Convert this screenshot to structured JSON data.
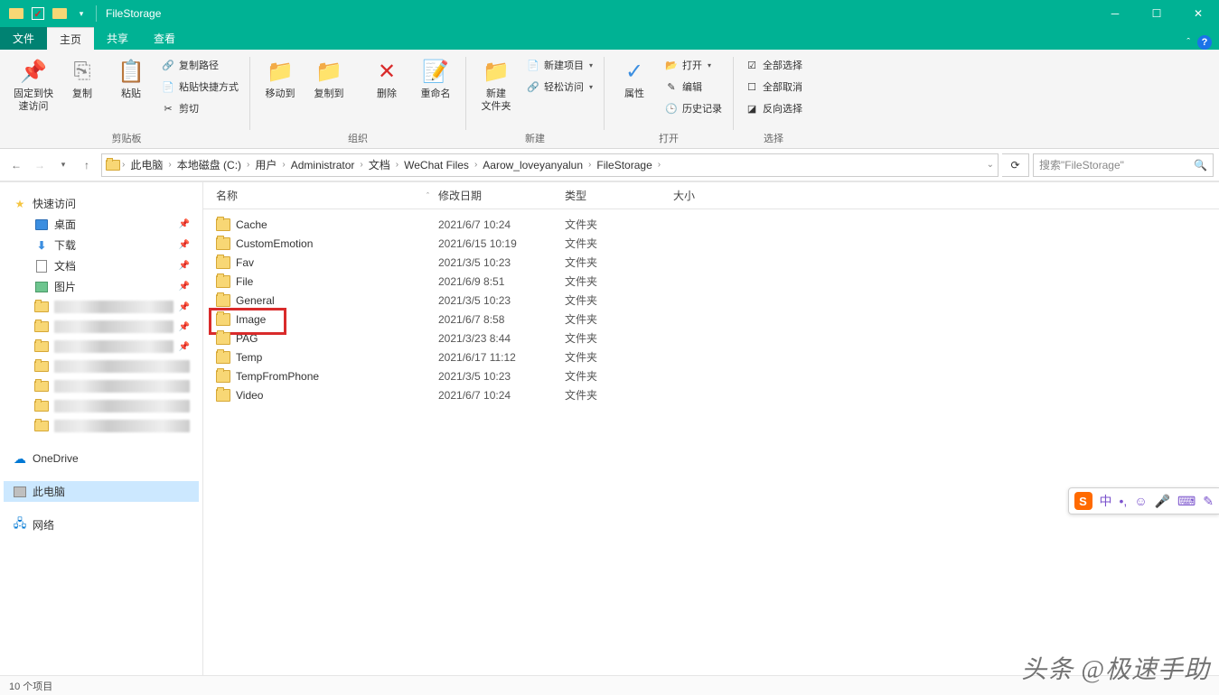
{
  "window": {
    "title": "FileStorage"
  },
  "menutabs": {
    "file": "文件",
    "home": "主页",
    "share": "共享",
    "view": "查看"
  },
  "ribbon": {
    "pin": "固定到快速访问",
    "copy": "复制",
    "paste": "粘贴",
    "copypath": "复制路径",
    "pasteshortcut": "粘贴快捷方式",
    "cut": "剪切",
    "clipboard_label": "剪贴板",
    "moveto": "移动到",
    "copyto": "复制到",
    "delete": "删除",
    "rename": "重命名",
    "organize_label": "组织",
    "newfolder": "新建\n文件夹",
    "newitem": "新建项目",
    "easyaccess": "轻松访问",
    "new_label": "新建",
    "properties": "属性",
    "open": "打开",
    "edit": "编辑",
    "history": "历史记录",
    "open_label": "打开",
    "selectall": "全部选择",
    "selectnone": "全部取消",
    "invert": "反向选择",
    "select_label": "选择"
  },
  "breadcrumb": [
    "此电脑",
    "本地磁盘 (C:)",
    "用户",
    "Administrator",
    "文档",
    "WeChat Files",
    "Aarow_loveyanyalun",
    "FileStorage"
  ],
  "search": {
    "placeholder": "搜索\"FileStorage\""
  },
  "tree": {
    "quick": "快速访问",
    "desktop": "桌面",
    "downloads": "下载",
    "documents": "文档",
    "pictures": "图片",
    "onedrive": "OneDrive",
    "thispc": "此电脑",
    "network": "网络"
  },
  "columns": {
    "name": "名称",
    "date": "修改日期",
    "type": "类型",
    "size": "大小"
  },
  "files": [
    {
      "name": "Cache",
      "date": "2021/6/7 10:24",
      "type": "文件夹"
    },
    {
      "name": "CustomEmotion",
      "date": "2021/6/15 10:19",
      "type": "文件夹"
    },
    {
      "name": "Fav",
      "date": "2021/3/5 10:23",
      "type": "文件夹"
    },
    {
      "name": "File",
      "date": "2021/6/9 8:51",
      "type": "文件夹"
    },
    {
      "name": "General",
      "date": "2021/3/5 10:23",
      "type": "文件夹"
    },
    {
      "name": "Image",
      "date": "2021/6/7 8:58",
      "type": "文件夹",
      "highlight": true
    },
    {
      "name": "PAG",
      "date": "2021/3/23 8:44",
      "type": "文件夹"
    },
    {
      "name": "Temp",
      "date": "2021/6/17 11:12",
      "type": "文件夹"
    },
    {
      "name": "TempFromPhone",
      "date": "2021/3/5 10:23",
      "type": "文件夹"
    },
    {
      "name": "Video",
      "date": "2021/6/7 10:24",
      "type": "文件夹"
    }
  ],
  "status": {
    "count": "10 个项目"
  },
  "ime": {
    "lang": "中"
  },
  "watermark": "头条 @极速手助"
}
